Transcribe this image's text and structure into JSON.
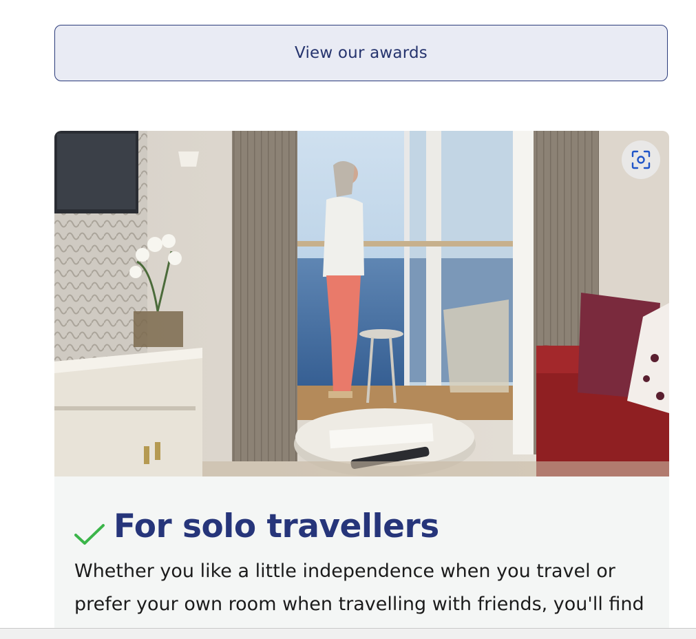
{
  "awards_button": {
    "label": "View our awards"
  },
  "feature_card": {
    "image_alt": "Woman looking out at the sea from a cruise cabin balcony",
    "lens_icon": "visual-search-icon",
    "check_icon": "checkmark-icon",
    "title": "For solo travellers",
    "body": "Whether you like a little independence when you travel or prefer your own room when travelling with friends, you'll find a welcoming cabin with no single supplement. Y"
  },
  "colors": {
    "brand_navy": "#26357a",
    "check_green": "#3bb54a",
    "button_bg": "#e9ebf4",
    "card_bg": "#f4f6f5"
  }
}
